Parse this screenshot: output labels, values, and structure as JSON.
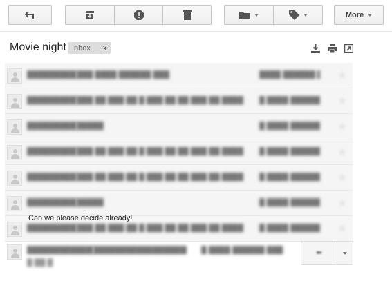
{
  "toolbar": {
    "back_icon": "back-arrow-icon",
    "archive_icon": "archive-icon",
    "spam_icon": "report-spam-icon",
    "delete_icon": "trash-icon",
    "move_icon": "folder-icon",
    "labels_icon": "label-tag-icon",
    "more_label": "More"
  },
  "conversation": {
    "subject": "Movie night",
    "label_chip": {
      "name": "Inbox",
      "remove": "x"
    },
    "actions": [
      "expand-all-icon",
      "print-icon",
      "new-window-icon"
    ]
  },
  "thread": {
    "collapsed_messages": [
      {
        "sender": "blurred-sender",
        "snippet": "blurred-snippet",
        "time": "blurred-time"
      },
      {
        "sender": "blurred-sender",
        "snippet": "blurred-snippet",
        "time": "blurred-time"
      },
      {
        "sender": "blurred-sender",
        "snippet": "blurred-snippet",
        "time": "blurred-time"
      },
      {
        "sender": "blurred-sender",
        "snippet": "blurred-snippet",
        "time": "blurred-time"
      },
      {
        "sender": "blurred-sender",
        "snippet": "blurred-snippet",
        "time": "blurred-time"
      },
      {
        "sender": "blurred-sender",
        "snippet": "blurred-snippet",
        "time": "blurred-time"
      },
      {
        "sender": "blurred-sender",
        "snippet": "blurred-snippet",
        "time": "blurred-time"
      }
    ],
    "open_message": {
      "body": "Can we please decide already!"
    }
  },
  "colors": {
    "toolbar_button_border": "#c6c6c6",
    "collapsed_row_bg": "#f5f5f5",
    "label_chip_bg": "#dddddd"
  }
}
